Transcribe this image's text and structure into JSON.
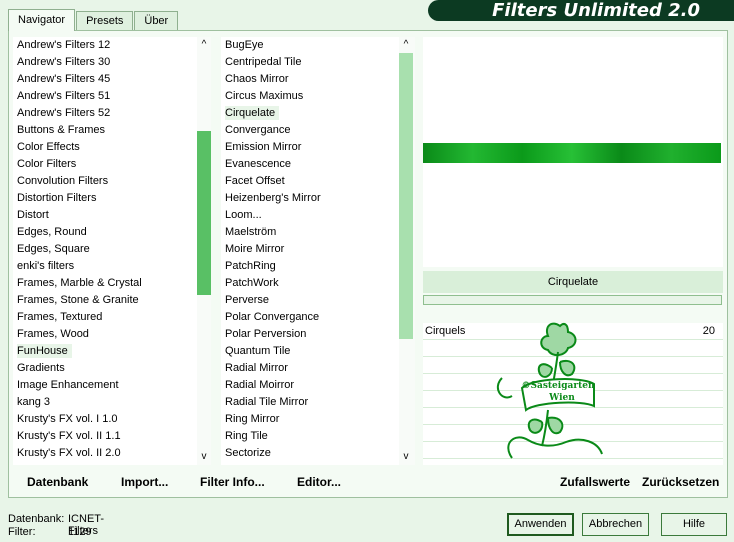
{
  "window": {
    "title": "Filters Unlimited 2.0"
  },
  "tabs": [
    {
      "label": "Navigator",
      "active": true
    },
    {
      "label": "Presets",
      "active": false
    },
    {
      "label": "Über",
      "active": false
    }
  ],
  "categories": {
    "items": [
      "Andrew's Filters 12",
      "Andrew's Filters 30",
      "Andrew's Filters 45",
      "Andrew's Filters 51",
      "Andrew's Filters 52",
      "Buttons & Frames",
      "Color Effects",
      "Color Filters",
      "Convolution Filters",
      "Distortion Filters",
      "Distort",
      "Edges, Round",
      "Edges, Square",
      "enki's filters",
      "Frames, Marble & Crystal",
      "Frames, Stone & Granite",
      "Frames, Textured",
      "Frames, Wood",
      "FunHouse",
      "Gradients",
      "Image Enhancement",
      "kang 3",
      "Krusty's FX vol. I 1.0",
      "Krusty's FX vol. II 1.1",
      "Krusty's FX vol. II 2.0"
    ],
    "selected": "FunHouse"
  },
  "filters": {
    "items": [
      "BugEye",
      "Centripedal Tile",
      "Chaos Mirror",
      "Circus Maximus",
      "Cirquelate",
      "Convergance",
      "Emission Mirror",
      "Evanescence",
      "Facet Offset",
      "Heizenberg's Mirror",
      "Loom...",
      "Maelström",
      "Moire Mirror",
      "PatchRing",
      "PatchWork",
      "Perverse",
      "Polar Convergance",
      "Polar Perversion",
      "Quantum Tile",
      "Radial Mirror",
      "Radial Moirror",
      "Radial Tile Mirror",
      "Ring Mirror",
      "Ring Tile",
      "Sectorize"
    ],
    "selected": "Cirquelate"
  },
  "preview": {
    "filter_name": "Cirquelate"
  },
  "parameters": [
    {
      "label": "Cirquels",
      "value": "20"
    }
  ],
  "watermark": {
    "line1": "©Sasteigarten",
    "line2": "Wien"
  },
  "toolbar": {
    "database": "Datenbank",
    "import": "Import...",
    "filter_info": "Filter Info...",
    "editor": "Editor...",
    "random": "Zufallswerte",
    "reset": "Zurücksetzen"
  },
  "status": {
    "database_label": "Datenbank:",
    "database_value": "ICNET-Filters",
    "filter_label": "Filter:",
    "filter_value": "1129"
  },
  "buttons": {
    "apply": "Anwenden",
    "cancel": "Abbrechen",
    "help": "Hilfe"
  },
  "colors": {
    "accent": "#59c065",
    "titlebar": "#0c3a22",
    "background": "#e8f5e8",
    "band": "#1aa828"
  }
}
